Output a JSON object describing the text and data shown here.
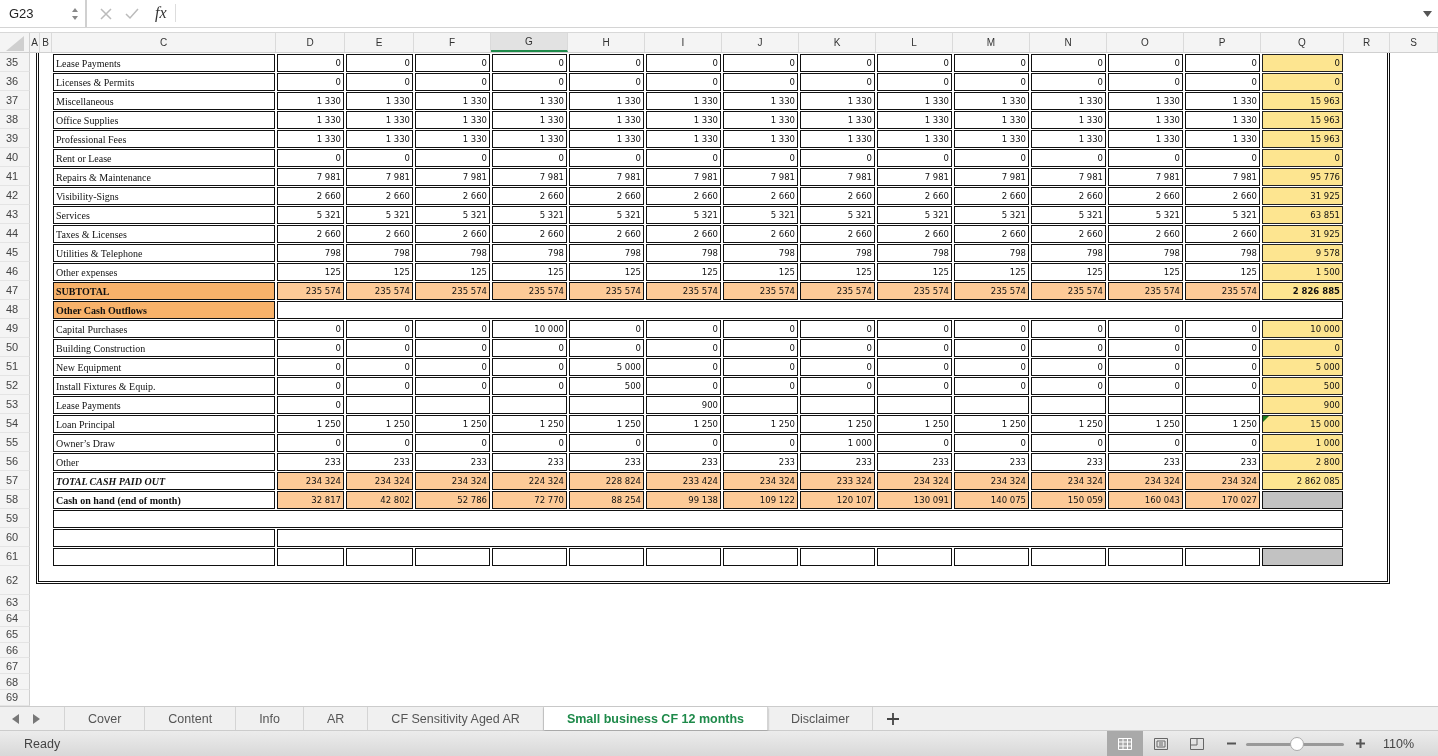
{
  "formula_bar": {
    "name_box": "G23",
    "fx_label": "fx"
  },
  "column_headers": [
    {
      "label": "A",
      "selected": false
    },
    {
      "label": "B",
      "selected": false
    },
    {
      "label": "C",
      "selected": false
    },
    {
      "label": "D",
      "selected": false
    },
    {
      "label": "E",
      "selected": false
    },
    {
      "label": "F",
      "selected": false
    },
    {
      "label": "G",
      "selected": true
    },
    {
      "label": "H",
      "selected": false
    },
    {
      "label": "I",
      "selected": false
    },
    {
      "label": "J",
      "selected": false
    },
    {
      "label": "K",
      "selected": false
    },
    {
      "label": "L",
      "selected": false
    },
    {
      "label": "M",
      "selected": false
    },
    {
      "label": "N",
      "selected": false
    },
    {
      "label": "O",
      "selected": false
    },
    {
      "label": "P",
      "selected": false
    },
    {
      "label": "Q",
      "selected": false
    },
    {
      "label": "R",
      "selected": false
    },
    {
      "label": "S",
      "selected": false
    }
  ],
  "rows": [
    {
      "number": "35",
      "kind": "item",
      "label": "Lease Payments",
      "values": [
        "0",
        "0",
        "0",
        "0",
        "0",
        "0",
        "0",
        "0",
        "0",
        "0",
        "0",
        "0",
        "0"
      ],
      "total": "0",
      "flagged": false
    },
    {
      "number": "36",
      "kind": "item",
      "label": "Licenses & Permits",
      "values": [
        "0",
        "0",
        "0",
        "0",
        "0",
        "0",
        "0",
        "0",
        "0",
        "0",
        "0",
        "0",
        "0"
      ],
      "total": "0",
      "flagged": false
    },
    {
      "number": "37",
      "kind": "item",
      "label": "Miscellaneous",
      "values": [
        "1 330",
        "1 330",
        "1 330",
        "1 330",
        "1 330",
        "1 330",
        "1 330",
        "1 330",
        "1 330",
        "1 330",
        "1 330",
        "1 330",
        "1 330"
      ],
      "total": "15 963",
      "flagged": false
    },
    {
      "number": "38",
      "kind": "item",
      "label": "Office Supplies",
      "values": [
        "1 330",
        "1 330",
        "1 330",
        "1 330",
        "1 330",
        "1 330",
        "1 330",
        "1 330",
        "1 330",
        "1 330",
        "1 330",
        "1 330",
        "1 330"
      ],
      "total": "15 963",
      "flagged": false
    },
    {
      "number": "39",
      "kind": "item",
      "label": "Professional Fees",
      "values": [
        "1 330",
        "1 330",
        "1 330",
        "1 330",
        "1 330",
        "1 330",
        "1 330",
        "1 330",
        "1 330",
        "1 330",
        "1 330",
        "1 330",
        "1 330"
      ],
      "total": "15 963",
      "flagged": false
    },
    {
      "number": "40",
      "kind": "item",
      "label": "Rent or Lease",
      "values": [
        "0",
        "0",
        "0",
        "0",
        "0",
        "0",
        "0",
        "0",
        "0",
        "0",
        "0",
        "0",
        "0"
      ],
      "total": "0",
      "flagged": false
    },
    {
      "number": "41",
      "kind": "item",
      "label": "Repairs & Maintenance",
      "values": [
        "7 981",
        "7 981",
        "7 981",
        "7 981",
        "7 981",
        "7 981",
        "7 981",
        "7 981",
        "7 981",
        "7 981",
        "7 981",
        "7 981",
        "7 981"
      ],
      "total": "95 776",
      "flagged": false
    },
    {
      "number": "42",
      "kind": "item",
      "label": "Visibility-Signs",
      "values": [
        "2 660",
        "2 660",
        "2 660",
        "2 660",
        "2 660",
        "2 660",
        "2 660",
        "2 660",
        "2 660",
        "2 660",
        "2 660",
        "2 660",
        "2 660"
      ],
      "total": "31 925",
      "flagged": false
    },
    {
      "number": "43",
      "kind": "item",
      "label": "Services",
      "values": [
        "5 321",
        "5 321",
        "5 321",
        "5 321",
        "5 321",
        "5 321",
        "5 321",
        "5 321",
        "5 321",
        "5 321",
        "5 321",
        "5 321",
        "5 321"
      ],
      "total": "63 851",
      "flagged": false
    },
    {
      "number": "44",
      "kind": "item",
      "label": "Taxes & Licenses",
      "values": [
        "2 660",
        "2 660",
        "2 660",
        "2 660",
        "2 660",
        "2 660",
        "2 660",
        "2 660",
        "2 660",
        "2 660",
        "2 660",
        "2 660",
        "2 660"
      ],
      "total": "31 925",
      "flagged": false
    },
    {
      "number": "45",
      "kind": "item",
      "label": "Utilities & Telephone",
      "values": [
        "798",
        "798",
        "798",
        "798",
        "798",
        "798",
        "798",
        "798",
        "798",
        "798",
        "798",
        "798",
        "798"
      ],
      "total": "9 578",
      "flagged": false
    },
    {
      "number": "46",
      "kind": "item",
      "label": "Other expenses",
      "values": [
        "125",
        "125",
        "125",
        "125",
        "125",
        "125",
        "125",
        "125",
        "125",
        "125",
        "125",
        "125",
        "125"
      ],
      "total": "1 500",
      "flagged": false
    },
    {
      "number": "47",
      "kind": "subtotal",
      "label": "SUBTOTAL",
      "values": [
        "235 574",
        "235 574",
        "235 574",
        "235 574",
        "235 574",
        "235 574",
        "235 574",
        "235 574",
        "235 574",
        "235 574",
        "235 574",
        "235 574",
        "235 574"
      ],
      "total": "2 826 885",
      "flagged": false
    },
    {
      "number": "48",
      "kind": "section",
      "label": "Other Cash Outflows"
    },
    {
      "number": "49",
      "kind": "item",
      "label": "Capital Purchases",
      "values": [
        "0",
        "0",
        "0",
        "10 000",
        "0",
        "0",
        "0",
        "0",
        "0",
        "0",
        "0",
        "0",
        "0"
      ],
      "total": "10 000",
      "flagged": false
    },
    {
      "number": "50",
      "kind": "item",
      "label": "Building Construction",
      "values": [
        "0",
        "0",
        "0",
        "0",
        "0",
        "0",
        "0",
        "0",
        "0",
        "0",
        "0",
        "0",
        "0"
      ],
      "total": "0",
      "flagged": false
    },
    {
      "number": "51",
      "kind": "item",
      "label": "New Equipment",
      "values": [
        "0",
        "0",
        "0",
        "0",
        "5 000",
        "0",
        "0",
        "0",
        "0",
        "0",
        "0",
        "0",
        "0"
      ],
      "total": "5 000",
      "flagged": false
    },
    {
      "number": "52",
      "kind": "item",
      "label": "Install Fixtures & Equip.",
      "values": [
        "0",
        "0",
        "0",
        "0",
        "500",
        "0",
        "0",
        "0",
        "0",
        "0",
        "0",
        "0",
        "0"
      ],
      "total": "500",
      "flagged": false
    },
    {
      "number": "53",
      "kind": "item",
      "label": "Lease Payments",
      "values": [
        {
          "kind": "number",
          "text": "0"
        },
        {
          "kind": "blank"
        },
        {
          "kind": "blank"
        },
        {
          "kind": "blank"
        },
        {
          "kind": "blank"
        },
        {
          "kind": "number",
          "text": "900"
        },
        {
          "kind": "blank"
        },
        {
          "kind": "blank"
        },
        {
          "kind": "blank"
        },
        {
          "kind": "blank"
        },
        {
          "kind": "blank"
        },
        {
          "kind": "blank"
        },
        {
          "kind": "blank"
        }
      ],
      "total": "900",
      "flagged": false
    },
    {
      "number": "54",
      "kind": "item",
      "label": "Loan Principal",
      "values": [
        "1 250",
        "1 250",
        "1 250",
        "1 250",
        "1 250",
        "1 250",
        "1 250",
        "1 250",
        "1 250",
        "1 250",
        "1 250",
        "1 250",
        "1 250"
      ],
      "total": "15 000",
      "flagged": true
    },
    {
      "number": "55",
      "kind": "item",
      "label": "Owner’s Draw",
      "values": [
        "0",
        "0",
        "0",
        "0",
        "0",
        "0",
        "0",
        "1 000",
        "0",
        "0",
        "0",
        "0",
        "0"
      ],
      "total": "1 000",
      "flagged": false
    },
    {
      "number": "56",
      "kind": "item",
      "label": "Other",
      "values": [
        "233",
        "233",
        "233",
        "233",
        "233",
        "233",
        "233",
        "233",
        "233",
        "233",
        "233",
        "233",
        "233"
      ],
      "total": "2 800",
      "flagged": false
    },
    {
      "number": "57",
      "kind": "total",
      "label": "TOTAL CASH PAID OUT",
      "values": [
        "234 324",
        "234 324",
        "234 324",
        "224 324",
        "228 824",
        "233 424",
        "234 324",
        "233 324",
        "234 324",
        "234 324",
        "234 324",
        "234 324",
        "234 324"
      ],
      "total": "2 862 085",
      "flagged": false
    },
    {
      "number": "58",
      "kind": "cash",
      "label": "Cash on hand (end of month)",
      "values": [
        "32 817",
        "42 802",
        "52 786",
        "72 770",
        "88 254",
        "99 138",
        "109 122",
        "120 107",
        "130 091",
        "140 075",
        "150 059",
        "160 043",
        "170 027"
      ],
      "flagged": false
    },
    {
      "number": "59",
      "kind": "merged_blank"
    },
    {
      "number": "60",
      "kind": "split_blank"
    },
    {
      "number": "61",
      "kind": "boxed_blank"
    },
    {
      "number": "62",
      "kind": "gap"
    },
    {
      "number": "63",
      "kind": "empty"
    },
    {
      "number": "64",
      "kind": "empty"
    },
    {
      "number": "65",
      "kind": "empty"
    },
    {
      "number": "66",
      "kind": "empty"
    },
    {
      "number": "67",
      "kind": "empty"
    },
    {
      "number": "68",
      "kind": "empty"
    },
    {
      "number": "69",
      "kind": "empty"
    }
  ],
  "sheet_tabs": [
    {
      "label": "Cover",
      "selected": false
    },
    {
      "label": "Content",
      "selected": false
    },
    {
      "label": "Info",
      "selected": false
    },
    {
      "label": "AR",
      "selected": false
    },
    {
      "label": "CF Sensitivity Aged AR",
      "selected": false
    },
    {
      "label": "Small business CF 12 months",
      "selected": true
    },
    {
      "label": "Disclaimer",
      "selected": false
    }
  ],
  "status_bar": {
    "status": "Ready",
    "view_buttons": [
      {
        "kind": "normal",
        "selected": true
      },
      {
        "kind": "page_layout",
        "selected": false
      },
      {
        "kind": "page_break",
        "selected": false
      }
    ],
    "zoom": {
      "label": "110%",
      "level": 0.52
    }
  }
}
